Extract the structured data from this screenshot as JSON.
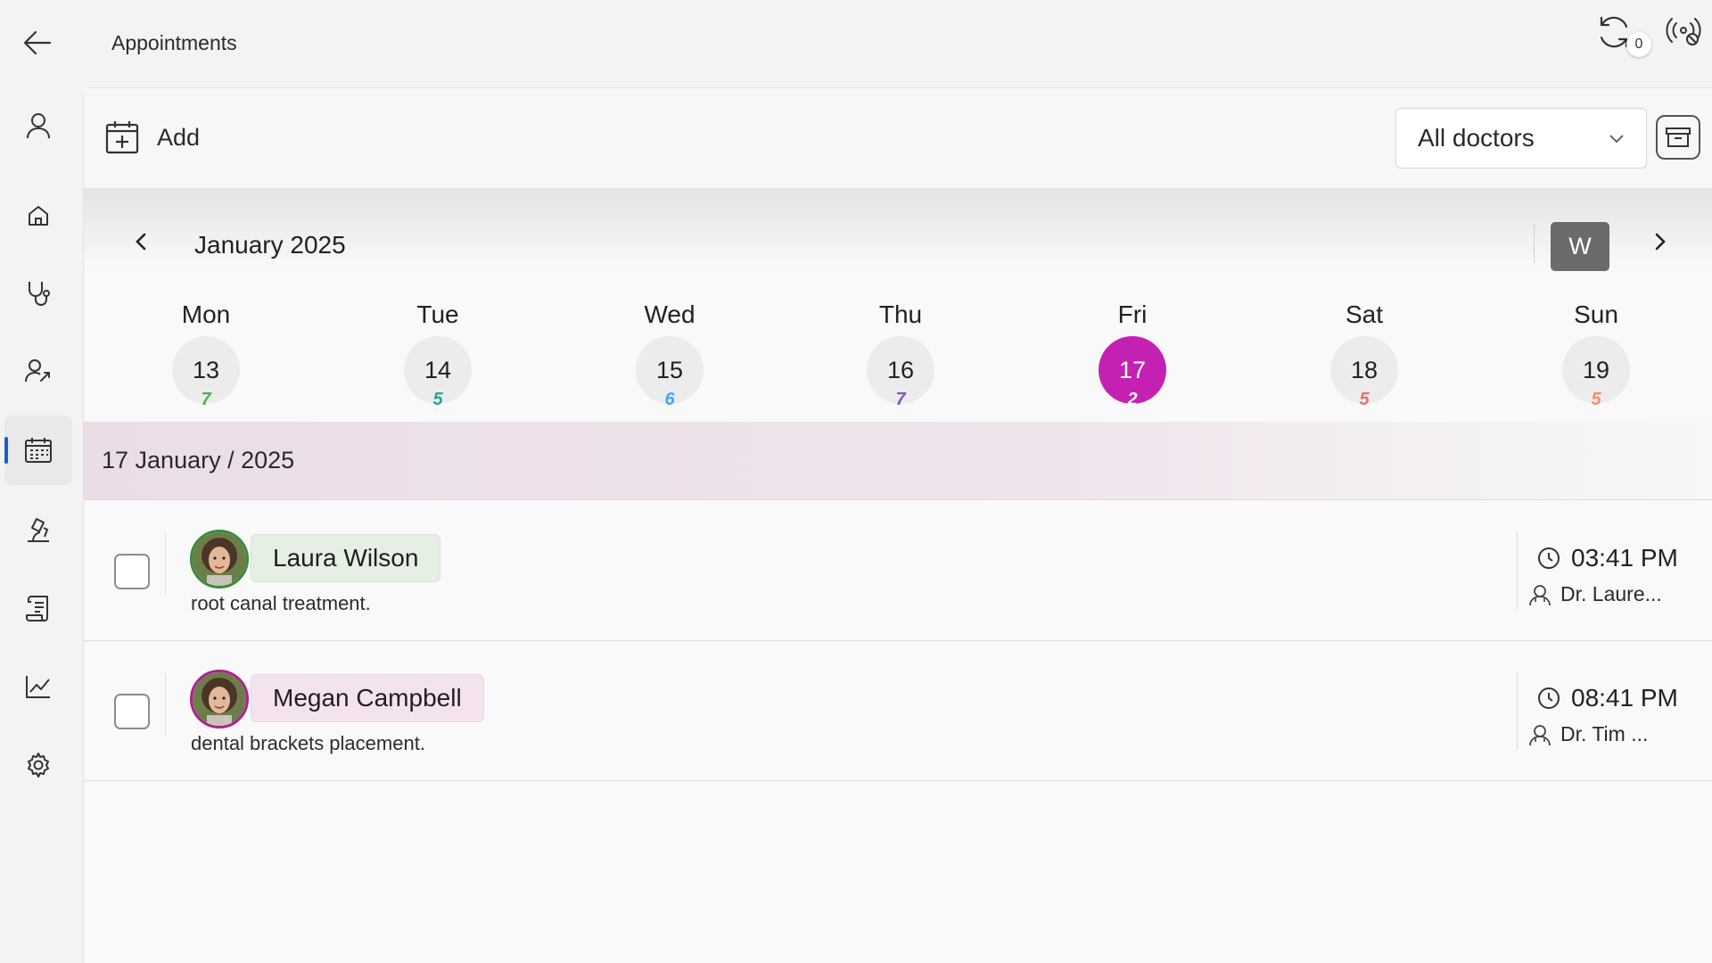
{
  "header": {
    "title": "Appointments",
    "sync_count": "0"
  },
  "sidebar": {
    "items": [
      {
        "name": "profile",
        "icon": "person-icon"
      },
      {
        "name": "home",
        "icon": "home-icon"
      },
      {
        "name": "doctors",
        "icon": "stethoscope-icon"
      },
      {
        "name": "patients",
        "icon": "patient-icon"
      },
      {
        "name": "appointments",
        "icon": "calendar-icon",
        "active": true
      },
      {
        "name": "labs",
        "icon": "microscope-icon"
      },
      {
        "name": "prescriptions",
        "icon": "scroll-icon"
      },
      {
        "name": "reports",
        "icon": "chart-icon"
      },
      {
        "name": "settings",
        "icon": "gear-icon"
      }
    ]
  },
  "toolbar": {
    "add_label": "Add",
    "doctor_filter": "All doctors"
  },
  "calendar": {
    "month_label": "January 2025",
    "view_label": "W",
    "days": [
      {
        "name": "Mon",
        "date": "13",
        "count": "7",
        "count_color": "#4caf50"
      },
      {
        "name": "Tue",
        "date": "14",
        "count": "5",
        "count_color": "#26a69a"
      },
      {
        "name": "Wed",
        "date": "15",
        "count": "6",
        "count_color": "#42a5f5"
      },
      {
        "name": "Thu",
        "date": "16",
        "count": "7",
        "count_color": "#7e57c2"
      },
      {
        "name": "Fri",
        "date": "17",
        "count": "2",
        "count_color": "#ffffff",
        "selected": true
      },
      {
        "name": "Sat",
        "date": "18",
        "count": "5",
        "count_color": "#e57373"
      },
      {
        "name": "Sun",
        "date": "19",
        "count": "5",
        "count_color": "#ff8a65"
      }
    ],
    "selected_color": "#c421b3"
  },
  "selected_date_label": "17 January / 2025",
  "appointments": [
    {
      "patient": "Laura Wilson",
      "description": "root canal treatment.",
      "time": "03:41 PM",
      "doctor": "Dr. Laure...",
      "chip_bg": "#e6efe4",
      "ring": "#3a8a3a"
    },
    {
      "patient": "Megan Campbell",
      "description": "dental brackets placement.",
      "time": "08:41 PM",
      "doctor": "Dr. Tim ...",
      "chip_bg": "#f4e2ef",
      "ring": "#b0208f"
    }
  ]
}
